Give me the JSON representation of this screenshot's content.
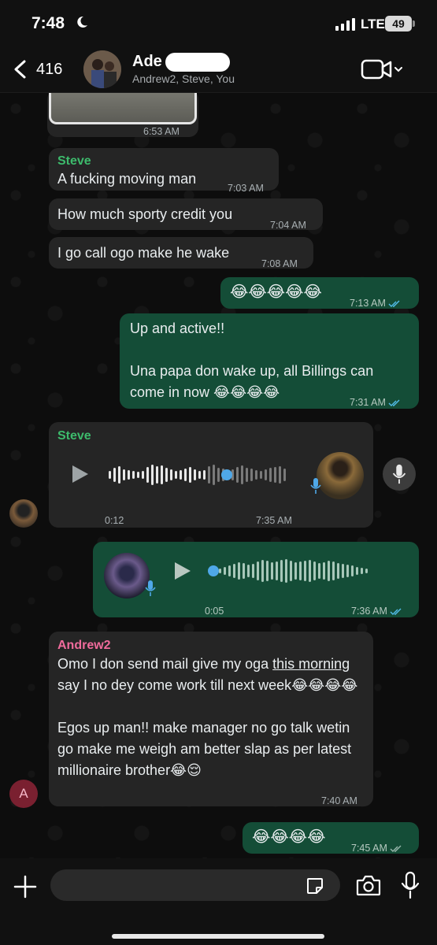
{
  "status_bar": {
    "time": "7:48",
    "network": "LTE",
    "battery": "49"
  },
  "header": {
    "back_count": "416",
    "group_name": "Ade",
    "members": "Andrew2, Steve, You"
  },
  "colors": {
    "outgoing": "#144d37",
    "incoming": "#252525",
    "steve": "#3dbb6c",
    "andrew": "#f06b9c",
    "read_tick": "#53bdeb"
  },
  "messages": [
    {
      "type": "image",
      "direction": "in",
      "time": "6:53 AM"
    },
    {
      "type": "text",
      "direction": "in",
      "sender": "Steve",
      "text": "A fucking moving man",
      "time": "7:03 AM"
    },
    {
      "type": "text",
      "direction": "in",
      "text": "How much sporty credit you",
      "time": "7:04 AM"
    },
    {
      "type": "text",
      "direction": "in",
      "text": "I go call ogo make he wake",
      "time": "7:08 AM"
    },
    {
      "type": "text",
      "direction": "out",
      "text": "😂😂😂😂😂",
      "time": "7:13 AM"
    },
    {
      "type": "text",
      "direction": "out",
      "text": "Up and active!!\n\nUna papa don wake up, all Billings can come in now 😂😂😂😂",
      "time": "7:31 AM"
    },
    {
      "type": "voice",
      "direction": "in",
      "sender": "Steve",
      "duration": "0:12",
      "time": "7:35 AM",
      "progress": 0.55
    },
    {
      "type": "voice",
      "direction": "out",
      "duration": "0:05",
      "time": "7:36 AM",
      "progress": 0
    },
    {
      "type": "text",
      "direction": "in",
      "sender": "Andrew2",
      "avatar_letter": "A",
      "text_parts": [
        "Omo I don send mail give my oga ",
        "this morning",
        " say I no dey come work till next week😂😂😂😂\n\nEgos up man!! make manager no go talk wetin go make me weigh am better slap as per latest millionaire brother😂😌"
      ],
      "time": "7:40 AM"
    },
    {
      "type": "text",
      "direction": "out",
      "text": "😂😂😂😂",
      "time": "7:45 AM"
    }
  ],
  "input": {
    "placeholder": ""
  }
}
